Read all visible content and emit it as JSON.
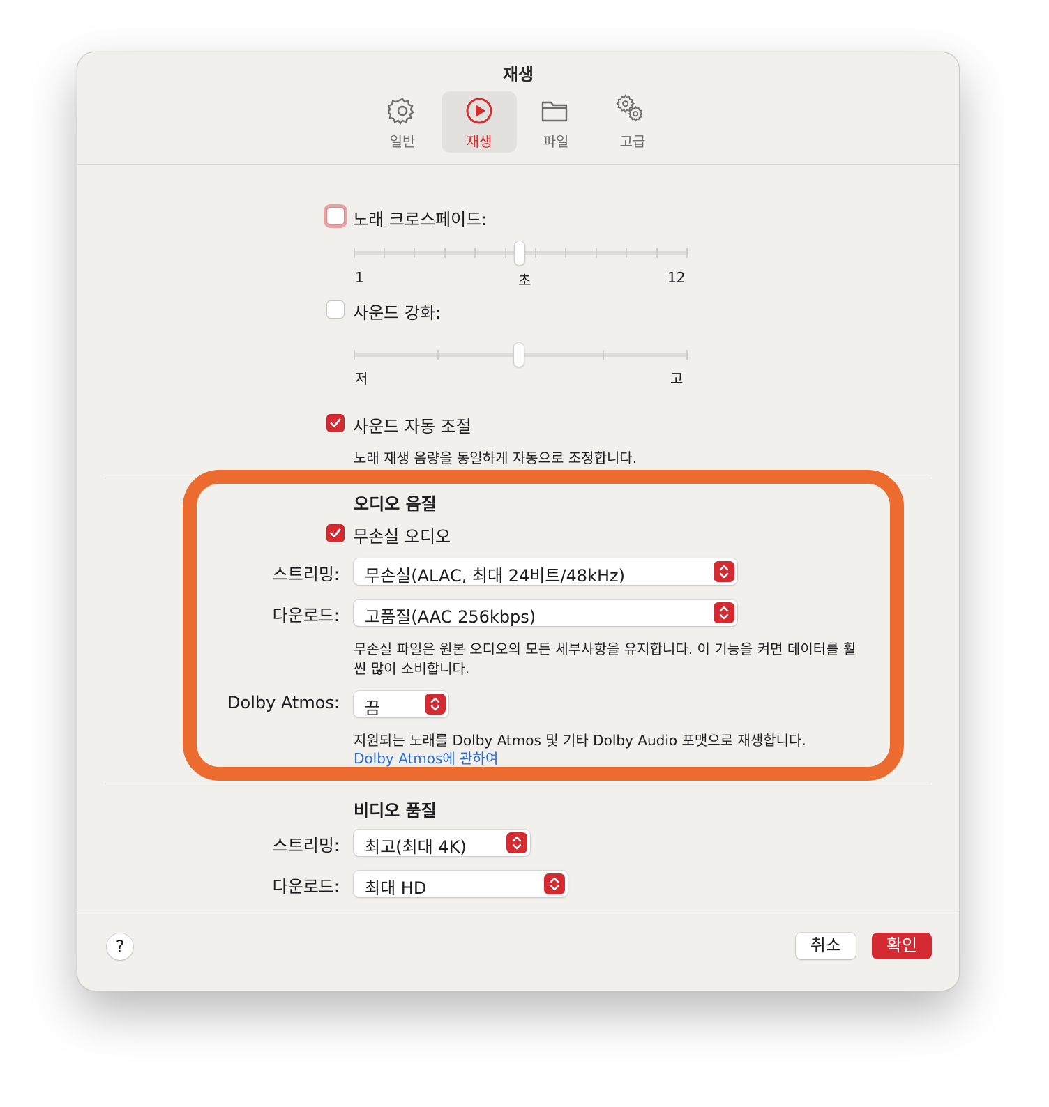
{
  "window": {
    "title": "재생"
  },
  "tabs": [
    {
      "label": "일반",
      "icon": "gear-icon"
    },
    {
      "label": "재생",
      "icon": "play-circle-icon",
      "active": true
    },
    {
      "label": "파일",
      "icon": "folder-icon"
    },
    {
      "label": "고급",
      "icon": "gears-icon"
    }
  ],
  "crossfade": {
    "label": "노래 크로스페이드:",
    "checked": false,
    "slider_min": "1",
    "slider_unit": "초",
    "slider_max": "12",
    "value_fraction": 0.5
  },
  "sound_enhancer": {
    "label": "사운드 강화:",
    "checked": false,
    "min_label": "저",
    "max_label": "고",
    "value_fraction": 0.5
  },
  "sound_check": {
    "label": "사운드 자동 조절",
    "checked": true,
    "description": "노래 재생 음량을 동일하게 자동으로 조정합니다."
  },
  "audio_quality": {
    "heading": "오디오 음질",
    "lossless_label": "무손실 오디오",
    "lossless_checked": true,
    "streaming_label": "스트리밍:",
    "streaming_value": "무손실(ALAC, 최대 24비트/48kHz)",
    "download_label": "다운로드:",
    "download_value": "고품질(AAC 256kbps)",
    "lossless_note_line1": "무손실 파일은 원본 오디오의 모든 세부사항을 유지합니다. 이 기능을 켜면 데이터를 훨",
    "lossless_note_line2": "씬 많이 소비합니다.",
    "dolby_label": "Dolby Atmos:",
    "dolby_value": "끔",
    "dolby_note": "지원되는 노래를 Dolby Atmos 및 기타 Dolby Audio 포맷으로 재생합니다.",
    "dolby_link": "Dolby Atmos에 관하여"
  },
  "video_quality": {
    "heading": "비디오 품질",
    "streaming_label": "스트리밍:",
    "streaming_value": "최고(최대 4K)",
    "download_label": "다운로드:",
    "download_value": "최대 HD"
  },
  "footer": {
    "help": "?",
    "cancel": "취소",
    "ok": "확인"
  },
  "colors": {
    "accent": "#d42b32",
    "highlight": "#ec6c2f",
    "link": "#2b6fd6"
  }
}
